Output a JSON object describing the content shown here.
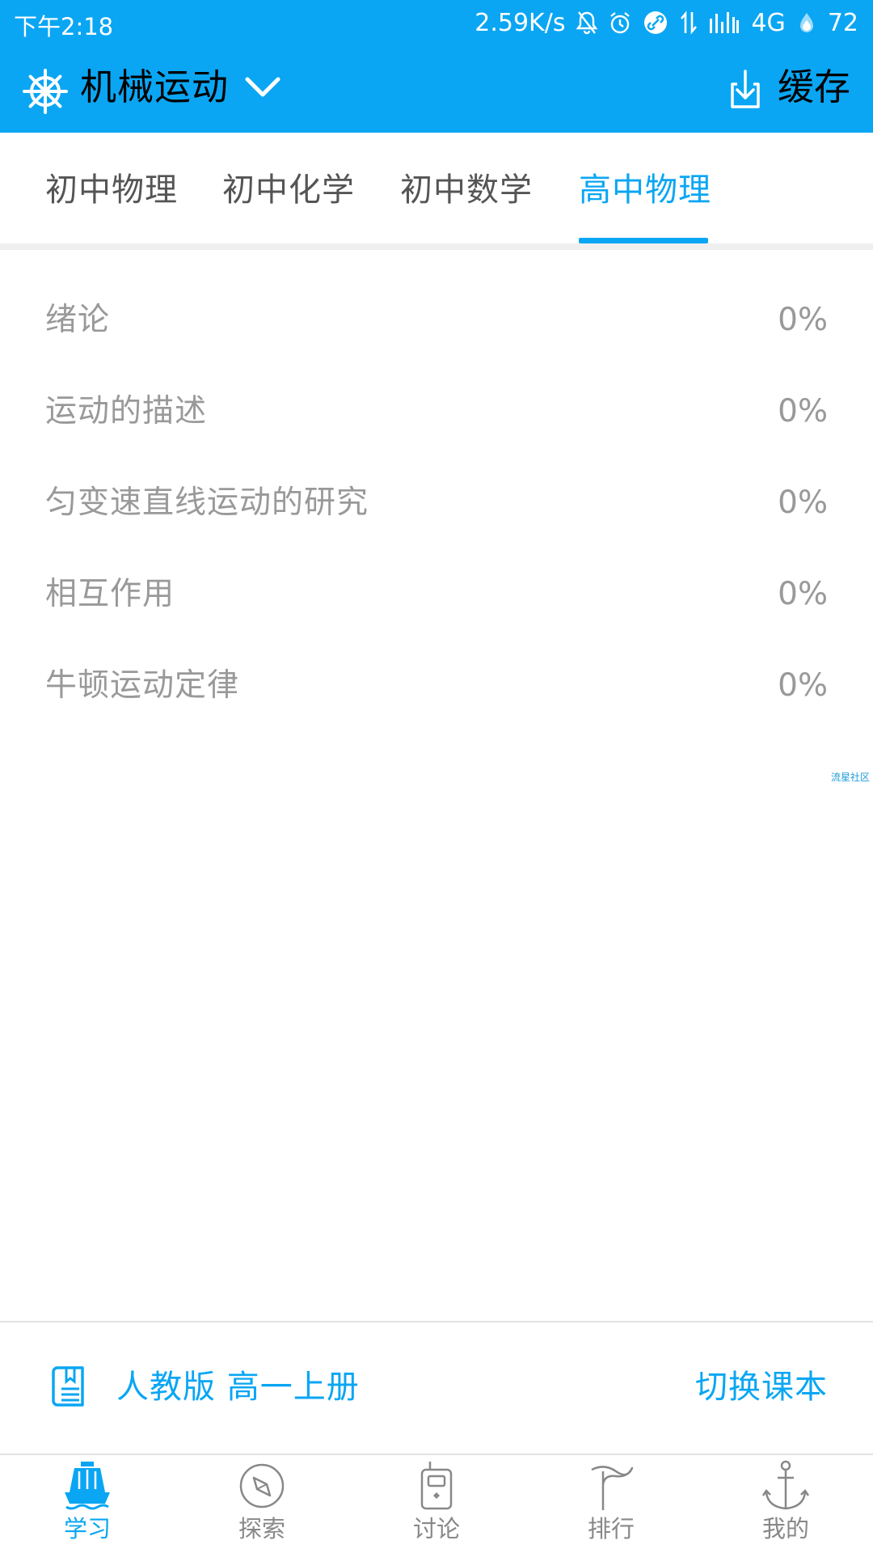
{
  "status_bar": {
    "time": "下午2:18",
    "speed": "2.59K/s",
    "network": "4G",
    "battery": "72",
    "icons": [
      "bell-off-icon",
      "alarm-icon",
      "link-icon",
      "data-transfer-icon",
      "signal-icon",
      "battery-icon"
    ]
  },
  "app_bar": {
    "course_title": "机械运动",
    "cache_label": "缓存",
    "icons": [
      "ship-wheel-icon",
      "chevron-down-icon",
      "download-icon"
    ]
  },
  "tabs": [
    {
      "label": "初中物理",
      "active": false
    },
    {
      "label": "初中化学",
      "active": false
    },
    {
      "label": "初中数学",
      "active": false
    },
    {
      "label": "高中物理",
      "active": true
    }
  ],
  "chapters": [
    {
      "title": "绪论",
      "progress": "0%"
    },
    {
      "title": "运动的描述",
      "progress": "0%"
    },
    {
      "title": "匀变速直线运动的研究",
      "progress": "0%"
    },
    {
      "title": "相互作用",
      "progress": "0%"
    },
    {
      "title": "牛顿运动定律",
      "progress": "0%"
    }
  ],
  "watermark": "流星社区",
  "textbook": {
    "name": "人教版 高一上册",
    "switch_label": "切换课本",
    "icon": "book-icon"
  },
  "bottom_nav": [
    {
      "label": "学习",
      "icon": "ship-icon",
      "active": true
    },
    {
      "label": "探索",
      "icon": "compass-icon",
      "active": false
    },
    {
      "label": "讨论",
      "icon": "walkie-talkie-icon",
      "active": false
    },
    {
      "label": "排行",
      "icon": "flag-icon",
      "active": false
    },
    {
      "label": "我的",
      "icon": "anchor-icon",
      "active": false
    }
  ],
  "colors": {
    "accent": "#0aa6f3",
    "text_muted": "#999999",
    "tab_inactive": "#555555",
    "divider": "#e2e2e2"
  }
}
